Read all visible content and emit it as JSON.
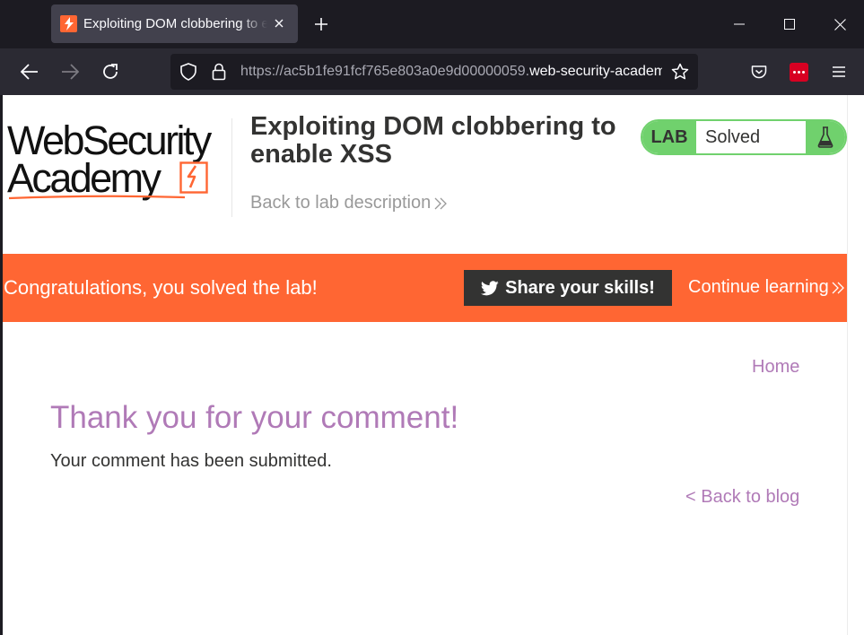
{
  "browser": {
    "tab_title": "Exploiting DOM clobbering to enable XSS",
    "url_host_prefix": "https://ac5b1fe91fcf765e803a0e9d00000059.",
    "url_host_main": "web-security-academy.net",
    "icons": [
      "back-icon",
      "forward-icon",
      "reload-icon",
      "shield-icon",
      "lock-icon",
      "star-icon",
      "pocket-icon",
      "extension-icon",
      "menu-icon"
    ]
  },
  "header": {
    "logo_line1": "WebSecurity",
    "logo_line2": "Academy",
    "lab_title": "Exploiting DOM clobbering to enable XSS",
    "back_link": "Back to lab description",
    "status_lab": "LAB",
    "status_text": "Solved",
    "status_color": "#70d16d"
  },
  "banner": {
    "message": "Congratulations, you solved the lab!",
    "share_label": "Share your skills!",
    "continue_label": "Continue learning",
    "color": "#ff6633"
  },
  "main": {
    "home_link": "Home",
    "heading": "Thank you for your comment!",
    "message": "Your comment has been submitted.",
    "back_link": "< Back to blog",
    "accent": "#b07ab7"
  }
}
